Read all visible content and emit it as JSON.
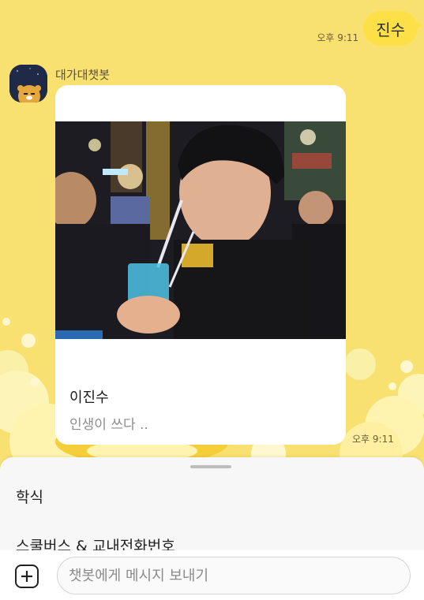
{
  "chat": {
    "sent_message": "진수",
    "sent_time": "오후 9:11",
    "sender_name": "대가대챗봇",
    "received_time": "오후 9:11"
  },
  "card": {
    "title": "이진수",
    "description": "인생이 쓰다 .."
  },
  "quick_menu": {
    "items": [
      "학식",
      "스쿨버스 & 교내전화번호"
    ]
  },
  "input": {
    "placeholder": "챗봇에게 메시지 보내기"
  },
  "colors": {
    "chat_bg": "#f8e170",
    "sent_bubble": "#fde047",
    "card_bg": "#ffffff"
  },
  "icons": {
    "add": "plus-square-icon"
  }
}
